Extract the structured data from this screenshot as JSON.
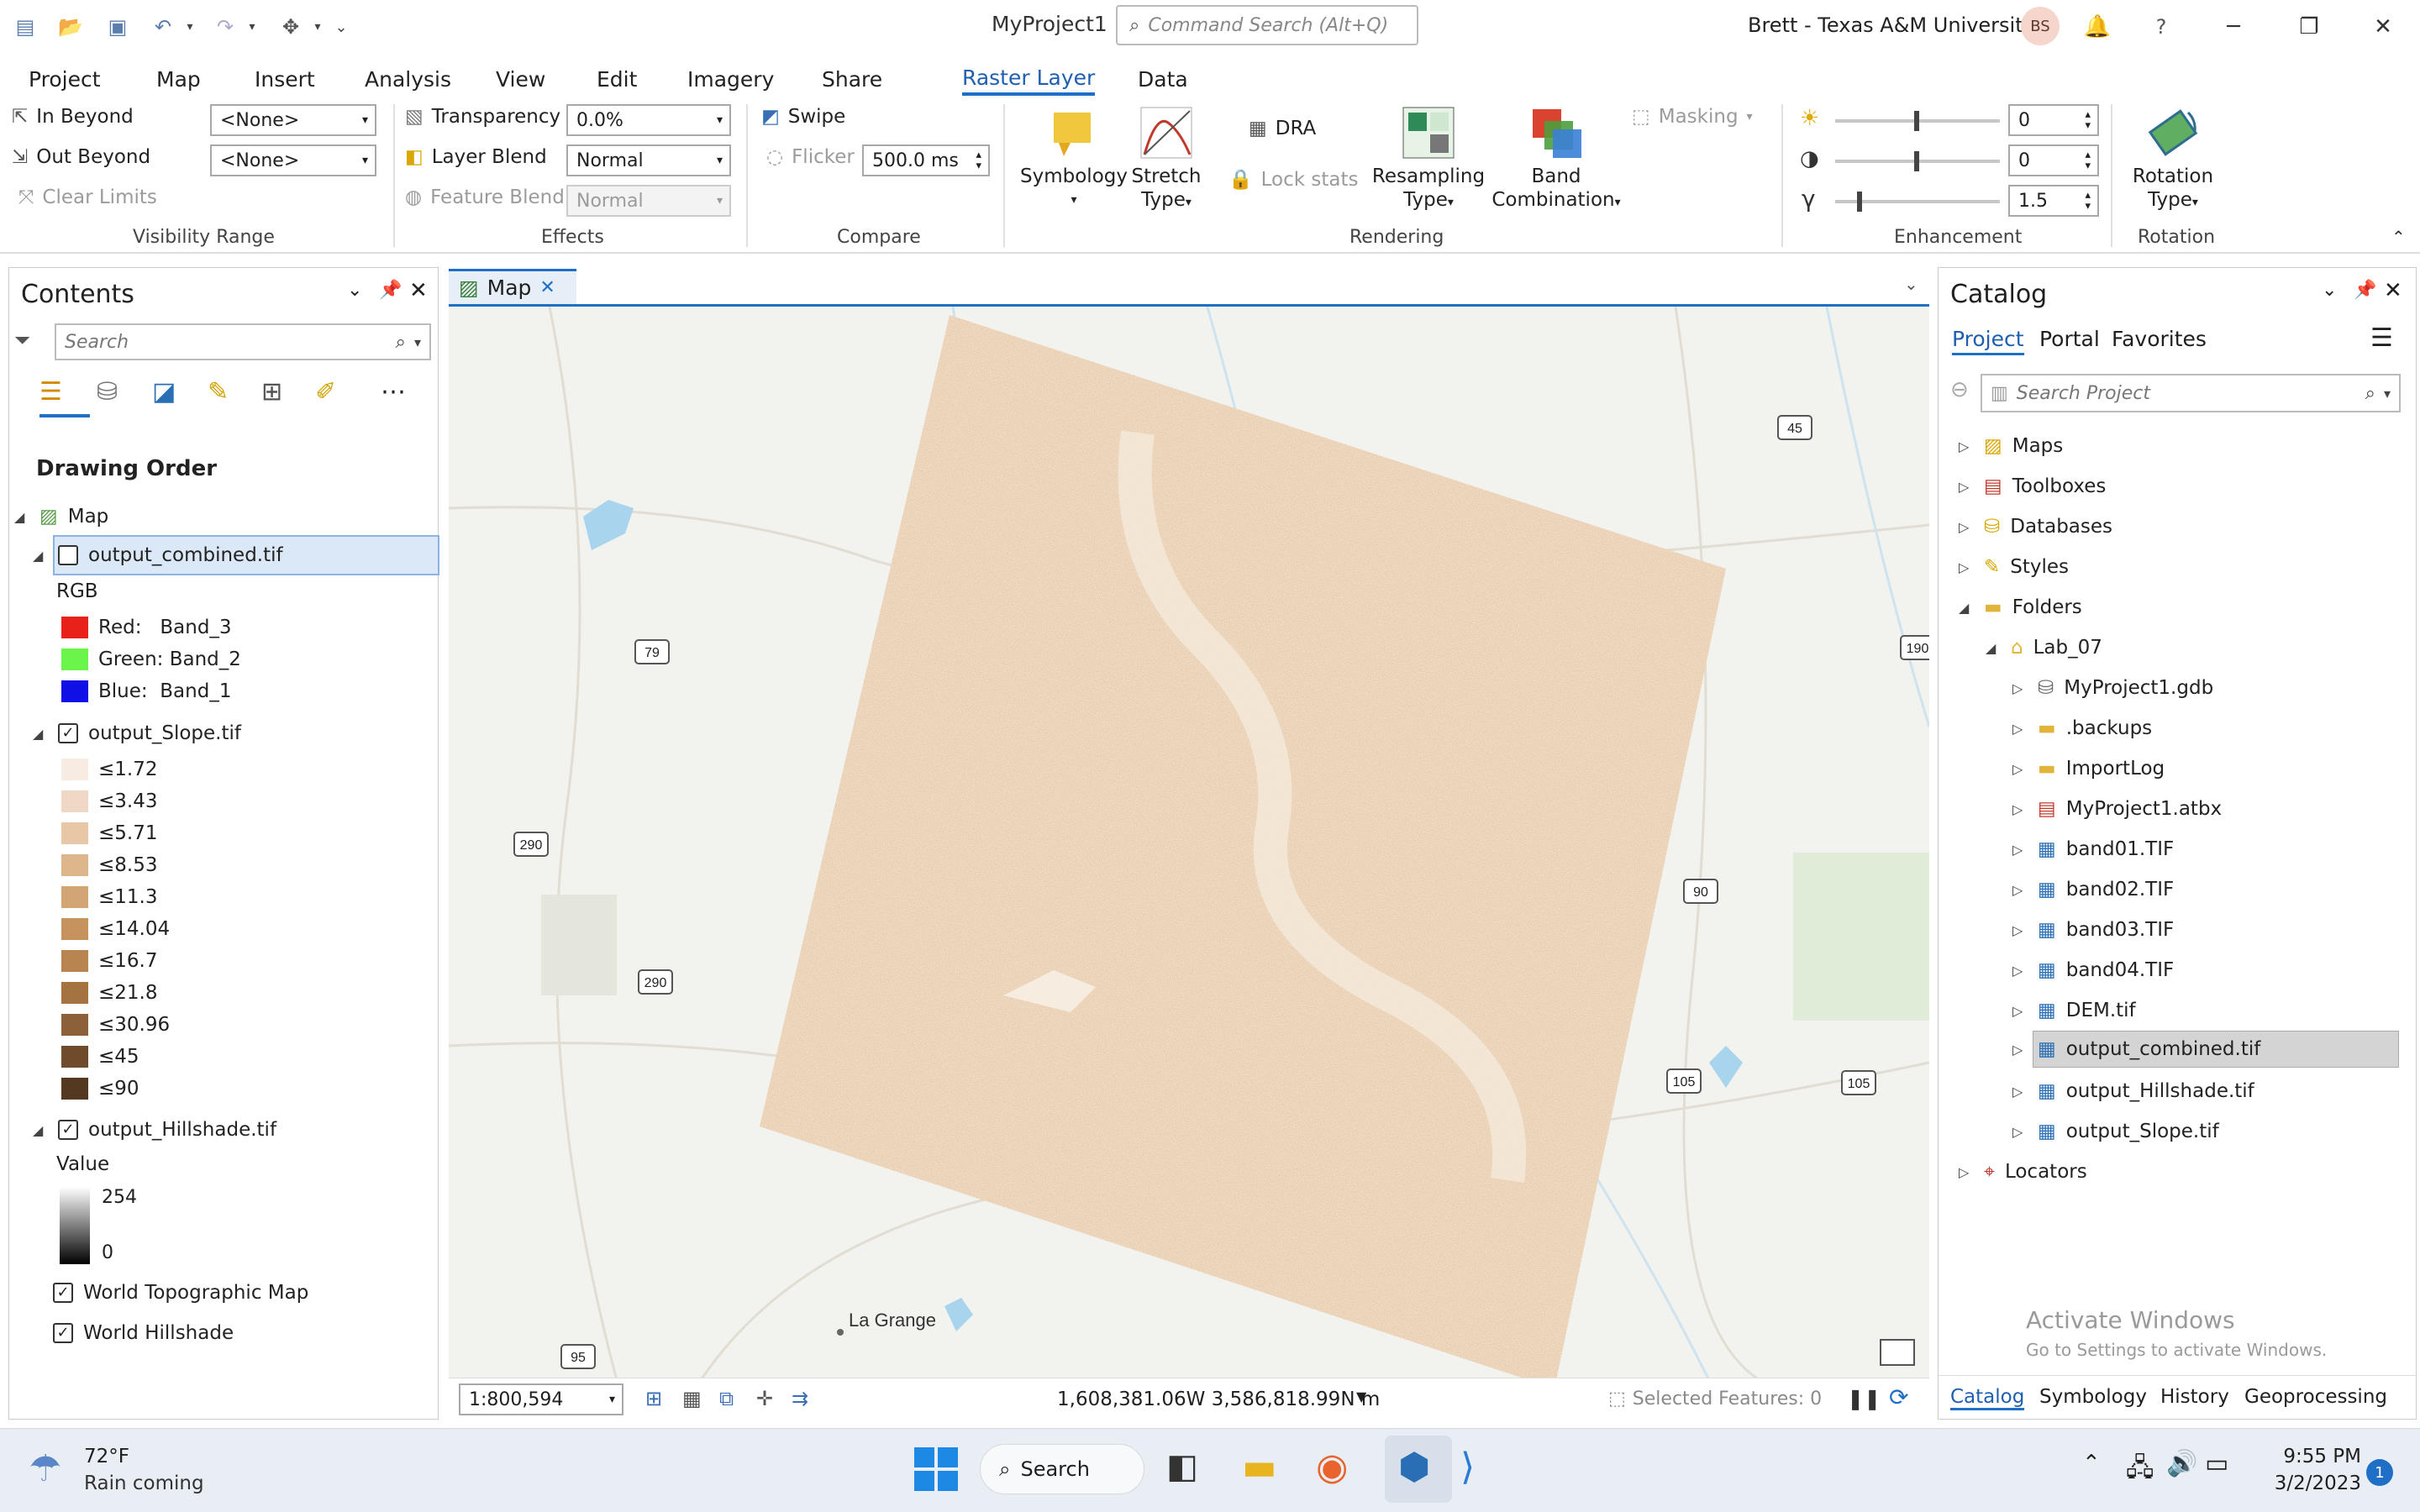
{
  "title_bar": {
    "project_title": "MyProject1",
    "command_search_placeholder": "Command Search (Alt+Q)",
    "user": "Brett - Texas A&M University",
    "avatar_initials": "BS"
  },
  "ribbon_tabs": [
    "Project",
    "Map",
    "Insert",
    "Analysis",
    "View",
    "Edit",
    "Imagery",
    "Share",
    "Raster Layer",
    "Data"
  ],
  "ribbon": {
    "visibility": {
      "in_beyond": "In Beyond",
      "out_beyond": "Out Beyond",
      "clear_limits": "Clear Limits",
      "in_value": "<None>",
      "out_value": "<None>",
      "group": "Visibility Range"
    },
    "effects": {
      "transparency": "Transparency",
      "transparency_value": "0.0%",
      "layer_blend": "Layer Blend",
      "layer_blend_value": "Normal",
      "feature_blend": "Feature Blend",
      "feature_blend_value": "Normal",
      "group": "Effects"
    },
    "compare": {
      "swipe": "Swipe",
      "flicker": "Flicker",
      "flicker_value": "500.0",
      "flicker_unit": "ms",
      "group": "Compare"
    },
    "rendering": {
      "symbology": "Symbology",
      "stretch": "Stretch",
      "stretch2": "Type",
      "dra": "DRA",
      "lock_stats": "Lock stats",
      "resampling": "Resampling",
      "resampling2": "Type",
      "band": "Band",
      "band2": "Combination",
      "masking": "Masking",
      "group": "Rendering"
    },
    "enhancement": {
      "brightness": "0",
      "contrast": "0",
      "gamma": "1.5",
      "group": "Enhancement"
    },
    "rotation": {
      "label1": "Rotation",
      "label2": "Type",
      "group": "Rotation"
    }
  },
  "contents": {
    "title": "Contents",
    "search_placeholder": "Search",
    "drawing_order": "Drawing Order",
    "map": "Map",
    "layers": {
      "combined": "output_combined.tif",
      "rgb": "RGB",
      "red": "Red:   Band_3",
      "green": "Green: Band_2",
      "blue": "Blue:  Band_1",
      "slope": "output_Slope.tif",
      "slope_classes": [
        {
          "label": "≤1.72",
          "color": "#f7ebe2"
        },
        {
          "label": "≤3.43",
          "color": "#efd8c6"
        },
        {
          "label": "≤5.71",
          "color": "#e7c7a6"
        },
        {
          "label": "≤8.53",
          "color": "#ddb68c"
        },
        {
          "label": "≤11.3",
          "color": "#d3a574"
        },
        {
          "label": "≤14.04",
          "color": "#c6935e"
        },
        {
          "label": "≤16.7",
          "color": "#b8844f"
        },
        {
          "label": "≤21.8",
          "color": "#a57342"
        },
        {
          "label": "≤30.96",
          "color": "#8c6038"
        },
        {
          "label": "≤45",
          "color": "#6f4b2c"
        },
        {
          "label": "≤90",
          "color": "#543920"
        }
      ],
      "hillshade": "output_Hillshade.tif",
      "value": "Value",
      "max": "254",
      "min": "0",
      "topo": "World Topographic Map",
      "world_hillshade": "World Hillshade"
    }
  },
  "map": {
    "tab": "Map",
    "shields": [
      "45",
      "79",
      "190",
      "290",
      "90",
      "290",
      "105",
      "105",
      "95"
    ],
    "town": "La Grange",
    "scale": "1:800,594",
    "coords": "1,608,381.06W 3,586,818.99N m",
    "selected": "Selected Features: 0"
  },
  "catalog": {
    "title": "Catalog",
    "tabs": [
      "Project",
      "Portal",
      "Favorites"
    ],
    "search_placeholder": "Search Project",
    "items": {
      "maps": "Maps",
      "toolboxes": "Toolboxes",
      "databases": "Databases",
      "styles": "Styles",
      "folders": "Folders",
      "lab": "Lab_07",
      "gdb": "MyProject1.gdb",
      "backups": ".backups",
      "importlog": "ImportLog",
      "atbx": "MyProject1.atbx",
      "b1": "band01.TIF",
      "b2": "band02.TIF",
      "b3": "band03.TIF",
      "b4": "band04.TIF",
      "dem": "DEM.tif",
      "combined": "output_combined.tif",
      "hillshade": "output_Hillshade.tif",
      "slope": "output_Slope.tif",
      "locators": "Locators"
    },
    "watermark1": "Activate Windows",
    "watermark2": "Go to Settings to activate Windows.",
    "bottom_tabs": [
      "Catalog",
      "Symbology",
      "History",
      "Geoprocessing"
    ]
  },
  "taskbar": {
    "temp": "72°F",
    "weather": "Rain coming",
    "search": "Search",
    "time": "9:55 PM",
    "date": "3/2/2023",
    "badge": "1"
  }
}
